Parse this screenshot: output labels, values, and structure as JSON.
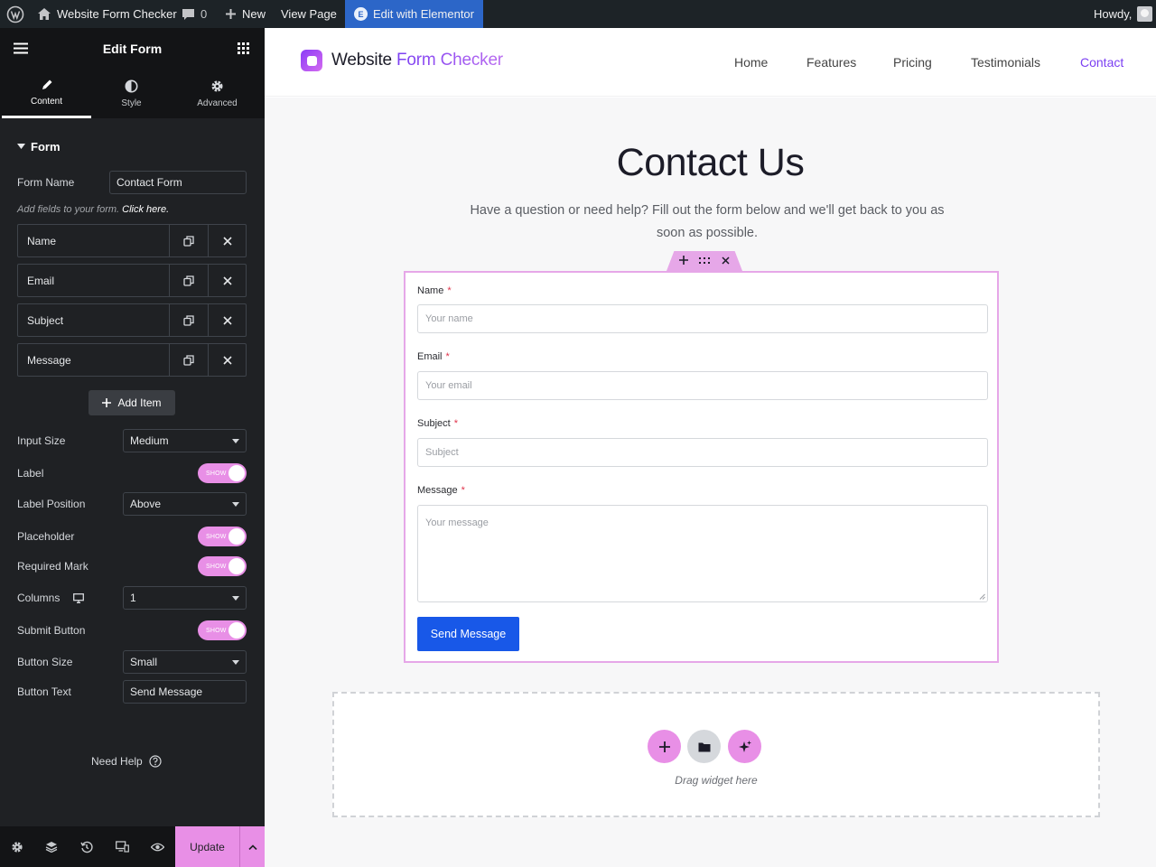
{
  "admin_bar": {
    "site_title": "Website Form Checker",
    "comments_count": "0",
    "new_label": "New",
    "view_page_label": "View Page",
    "edit_label": "Edit with Elementor",
    "howdy_label": "Howdy,"
  },
  "panel": {
    "title": "Edit Form",
    "tabs": [
      {
        "label": "Content"
      },
      {
        "label": "Style"
      },
      {
        "label": "Advanced"
      }
    ],
    "section_title": "Form",
    "form_name_label": "Form Name",
    "form_name_value": "Contact Form",
    "hint_text": "Add fields to your form.",
    "hint_link": "Click here.",
    "fields": [
      {
        "label": "Name"
      },
      {
        "label": "Email"
      },
      {
        "label": "Subject"
      },
      {
        "label": "Message"
      }
    ],
    "add_item_label": "Add Item",
    "settings": {
      "input_size": {
        "label": "Input Size",
        "value": "Medium"
      },
      "label": {
        "label": "Label",
        "toggle": "SHOW"
      },
      "label_position": {
        "label": "Label Position",
        "value": "Above"
      },
      "placeholder": {
        "label": "Placeholder",
        "toggle": "SHOW"
      },
      "required_mark": {
        "label": "Required Mark",
        "toggle": "SHOW"
      },
      "columns": {
        "label": "Columns",
        "value": "1"
      },
      "submit_button": {
        "label": "Submit Button",
        "toggle": "SHOW"
      },
      "button_size": {
        "label": "Button Size",
        "value": "Small"
      },
      "button_text": {
        "label": "Button Text",
        "value": "Send Message"
      }
    },
    "need_help_label": "Need Help",
    "update_label": "Update"
  },
  "site": {
    "logo_text_dark": "Website",
    "logo_text_accent": "Form Checker",
    "nav": [
      {
        "label": "Home"
      },
      {
        "label": "Features"
      },
      {
        "label": "Pricing"
      },
      {
        "label": "Testimonials"
      },
      {
        "label": "Contact"
      }
    ],
    "page_title": "Contact Us",
    "page_subtitle": "Have a question or need help? Fill out the form below and we'll get back to you as soon as possible.",
    "form": {
      "required_symbol": "*",
      "fields": [
        {
          "label": "Name",
          "placeholder": "Your name"
        },
        {
          "label": "Email",
          "placeholder": "Your email"
        },
        {
          "label": "Subject",
          "placeholder": "Subject"
        },
        {
          "label": "Message",
          "placeholder": "Your message"
        }
      ],
      "submit_label": "Send Message"
    },
    "drop_zone_text": "Drag widget here"
  },
  "colors": {
    "accent_pink": "#e88fe6",
    "brand_purple": "#7b3ff2",
    "submit_blue": "#1858e8",
    "admin_bar": "#1d2327",
    "panel_bg": "#1f2124"
  }
}
